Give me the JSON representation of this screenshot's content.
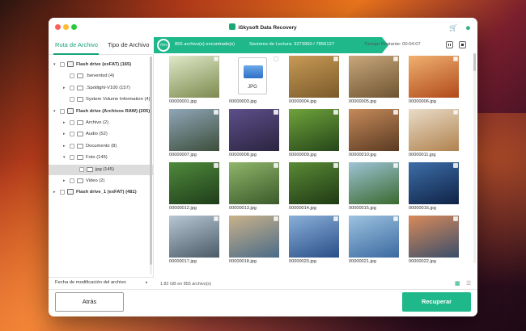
{
  "app": {
    "title": "iSkysoft Data Recovery"
  },
  "tabs": [
    {
      "label": "Ruta de Archivo"
    },
    {
      "label": "Tipo de Archivo"
    }
  ],
  "tree": [
    {
      "label": "Flash drive (exFAT) (165)",
      "level": 0,
      "arrow": "expanded",
      "kind": "drive",
      "bold": true
    },
    {
      "label": ".fseventsd (4)",
      "level": 1,
      "arrow": "none",
      "kind": "folder"
    },
    {
      "label": ".Spotlight-V100 (157)",
      "level": 1,
      "arrow": "collapsed",
      "kind": "folder"
    },
    {
      "label": "System Volume Information (4)",
      "level": 1,
      "arrow": "none",
      "kind": "folder"
    },
    {
      "label": "Flash drive (Archivos RAW) (205)",
      "level": 0,
      "arrow": "expanded",
      "kind": "drive",
      "bold": true
    },
    {
      "label": "Archivo (2)",
      "level": 1,
      "arrow": "collapsed",
      "kind": "folder"
    },
    {
      "label": "Audio (52)",
      "level": 1,
      "arrow": "collapsed",
      "kind": "folder"
    },
    {
      "label": "Documento (8)",
      "level": 1,
      "arrow": "collapsed",
      "kind": "folder"
    },
    {
      "label": "Foto (145)",
      "level": 1,
      "arrow": "expanded",
      "kind": "folder"
    },
    {
      "label": "jpg (145)",
      "level": 2,
      "arrow": "none",
      "kind": "folder",
      "selected": true
    },
    {
      "label": "Video (2)",
      "level": 1,
      "arrow": "collapsed",
      "kind": "folder"
    },
    {
      "label": "Flash drive_1 (exFAT) (481)",
      "level": 0,
      "arrow": "collapsed",
      "kind": "drive",
      "bold": true
    }
  ],
  "filter": {
    "label": "Fecha de modificación del archivo"
  },
  "status": {
    "progress": 0.7,
    "progress_label": "70%",
    "found": "855 archivo(s) encontrado(s)",
    "sectors": "Sectores de Lectura: 3273950 / 7856127",
    "time": "Tiempo Restante: 00:04:07"
  },
  "files": [
    {
      "name": "00000001.jpg",
      "c1": "#dfe9c9",
      "c2": "#7d8a4e"
    },
    {
      "name": "00000003.jpg",
      "c1": "#ffffff",
      "c2": "#ffffff",
      "doc": true,
      "doc_label": "JPG"
    },
    {
      "name": "00000004.jpg",
      "c1": "#c89a55",
      "c2": "#7a5a2a"
    },
    {
      "name": "00000005.jpg",
      "c1": "#c9a77a",
      "c2": "#6e5533"
    },
    {
      "name": "00000006.jpg",
      "c1": "#f0b070",
      "c2": "#b04a1a"
    },
    {
      "name": "00000007.jpg",
      "c1": "#8fa6b8",
      "c2": "#3d4e3a"
    },
    {
      "name": "00000008.jpg",
      "c1": "#5d4f8a",
      "c2": "#2b2440"
    },
    {
      "name": "00000009.jpg",
      "c1": "#6fa33b",
      "c2": "#26461a"
    },
    {
      "name": "00000010.jpg",
      "c1": "#c58a5a",
      "c2": "#5a3a22"
    },
    {
      "name": "00000011.jpg",
      "c1": "#e9dcc8",
      "c2": "#b0824e"
    },
    {
      "name": "00000012.jpg",
      "c1": "#4f8a3c",
      "c2": "#1f3d1a"
    },
    {
      "name": "00000013.jpg",
      "c1": "#8fb56a",
      "c2": "#3b5a2a"
    },
    {
      "name": "00000014.jpg",
      "c1": "#5a8a36",
      "c2": "#1f3a14"
    },
    {
      "name": "00000015.jpg",
      "c1": "#9ec3d6",
      "c2": "#3a6a2e"
    },
    {
      "name": "00000016.jpg",
      "c1": "#3d6ea8",
      "c2": "#0f2346"
    },
    {
      "name": "00000017.jpg",
      "c1": "#b8c7d4",
      "c2": "#4a5a66"
    },
    {
      "name": "00000018.jpg",
      "c1": "#c9b28a",
      "c2": "#4a6b88"
    },
    {
      "name": "00000020.jpg",
      "c1": "#8ab0d8",
      "c2": "#2a4e88"
    },
    {
      "name": "00000021.jpg",
      "c1": "#9ec2e0",
      "c2": "#3a6aa0"
    },
    {
      "name": "00000022.jpg",
      "c1": "#d98a5a",
      "c2": "#3a4e6a"
    },
    {
      "name": "",
      "c1": "#8fa6b8",
      "c2": "#6a7a88"
    },
    {
      "name": "",
      "c1": "#a8b8c8",
      "c2": "#7a8898"
    },
    {
      "name": "",
      "c1": "#c8c8c8",
      "c2": "#9a9a9a"
    },
    {
      "name": "",
      "c1": "#b0c4d8",
      "c2": "#8098b0"
    },
    {
      "name": "",
      "c1": "#d8d0c0",
      "c2": "#a89878"
    }
  ],
  "footer": {
    "info": "1.82 GB en 855 archivo(s)"
  },
  "buttons": {
    "back": "Atrás",
    "recover": "Recuperar"
  },
  "colors": {
    "accent": "#1fb88a"
  },
  "icons": {
    "cart": "cart-icon",
    "user": "user-icon",
    "pause": "pause-icon",
    "stop": "stop-icon",
    "grid_view": "grid-view-icon",
    "list_view": "list-view-icon"
  }
}
